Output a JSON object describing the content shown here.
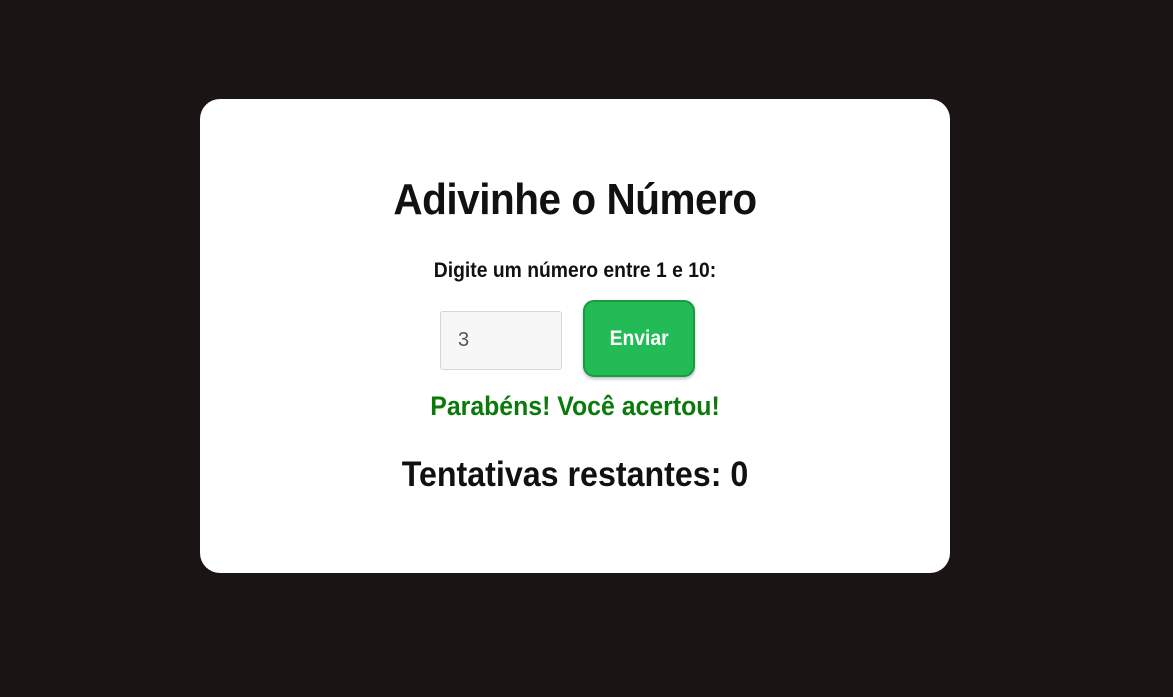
{
  "game": {
    "title": "Adivinhe o Número",
    "prompt": "Digite um número entre 1 e 10:",
    "input": {
      "value": "3",
      "placeholder": ""
    },
    "submit_label": "Enviar",
    "feedback": "Parabéns! Você acertou!",
    "attempts_label": "Tentativas restantes: 0"
  },
  "colors": {
    "background": "#1a1414",
    "card": "#ffffff",
    "button": "#22bb55",
    "success_text": "#0b7a0b"
  }
}
